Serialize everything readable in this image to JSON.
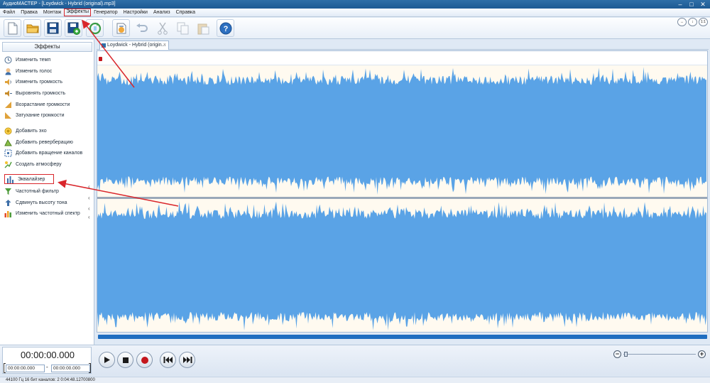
{
  "window": {
    "title": "АудиоМАСТЕР - [Loydwick - Hybrid (original).mp3]"
  },
  "menu": {
    "items": [
      {
        "label": "Файл"
      },
      {
        "label": "Правка"
      },
      {
        "label": "Монтаж"
      },
      {
        "label": "Эффекты",
        "highlighted": true
      },
      {
        "label": "Генератор"
      },
      {
        "label": "Настройки"
      },
      {
        "label": "Анализ"
      },
      {
        "label": "Справка"
      }
    ]
  },
  "toolbar": {
    "buttons": [
      {
        "icon": "new-file-icon"
      },
      {
        "icon": "open-folder-icon"
      },
      {
        "icon": "save-icon"
      },
      {
        "icon": "save-as-icon"
      },
      {
        "icon": "refresh-icon"
      },
      {
        "icon": "audio-info-icon"
      },
      {
        "icon": "undo-icon",
        "disabled": true
      },
      {
        "icon": "cut-icon",
        "disabled": true
      },
      {
        "icon": "copy-icon",
        "disabled": true
      },
      {
        "icon": "paste-icon",
        "disabled": true
      },
      {
        "icon": "help-icon"
      }
    ]
  },
  "effects_panel": {
    "header": "Эффекты",
    "items": [
      {
        "label": "Изменить темп",
        "icon": "tempo-icon"
      },
      {
        "label": "Изменить голос",
        "icon": "voice-icon"
      },
      {
        "label": "Изменить громкость",
        "icon": "volume-icon"
      },
      {
        "label": "Выровнять громкость",
        "icon": "normalize-icon"
      },
      {
        "label": "Возрастание громкости",
        "icon": "fade-in-icon"
      },
      {
        "label": "Затухание громкости",
        "icon": "fade-out-icon"
      },
      {
        "label": "Добавить эхо",
        "icon": "echo-icon"
      },
      {
        "label": "Добавить реверберацию",
        "icon": "reverb-icon"
      },
      {
        "label": "Добавить вращение каналов",
        "icon": "channel-rotate-icon"
      },
      {
        "label": "Создать атмосферу",
        "icon": "atmosphere-icon"
      },
      {
        "label": "Эквалайзер",
        "icon": "equalizer-icon",
        "highlighted": true
      },
      {
        "label": "Частотный фильтр",
        "icon": "filter-icon"
      },
      {
        "label": "Сдвинуть высоту тона",
        "icon": "pitch-icon"
      },
      {
        "label": "Изменить частотный спектр",
        "icon": "spectrum-icon"
      }
    ]
  },
  "document_tab": {
    "label": "Loydwick - Hybrid (origin...",
    "close": "×"
  },
  "transport": {
    "current_time": "00:00:00.000",
    "range_from": "00:00:00.000",
    "range_to": "00:00:00.000",
    "range_separator": "-"
  },
  "zoom": {
    "minus": "−",
    "plus": "+",
    "fit_label": "↔",
    "range_label": "↕",
    "one_to_one": "1:1"
  },
  "status": {
    "text": "44100 Гц  16 бит  каналов: 2   0:04:48.12700800"
  },
  "colors": {
    "waveform": "#5aa3e6",
    "wave_bg": "#fffaf0",
    "highlight": "#d9262b",
    "scrollbar": "#1f6ec0"
  }
}
